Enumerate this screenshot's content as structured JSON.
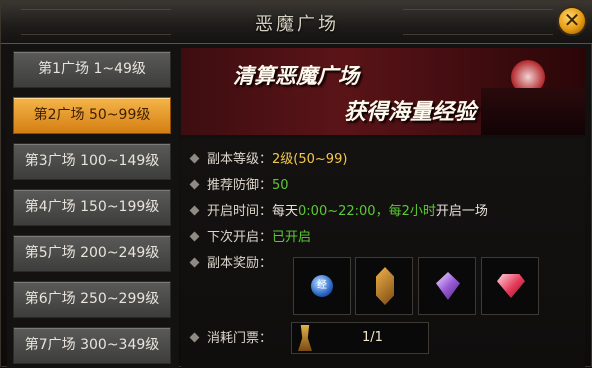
{
  "window": {
    "title": "恶魔广场"
  },
  "sidebar": {
    "items": [
      {
        "label": "第1广场 1~49级",
        "active": false
      },
      {
        "label": "第2广场 50~99级",
        "active": true
      },
      {
        "label": "第3广场 100~149级",
        "active": false
      },
      {
        "label": "第4广场 150~199级",
        "active": false
      },
      {
        "label": "第5广场 200~249级",
        "active": false
      },
      {
        "label": "第6广场 250~299级",
        "active": false
      },
      {
        "label": "第7广场 300~349级",
        "active": false
      }
    ]
  },
  "banner": {
    "line1": "清算恶魔广场",
    "line2": "获得海量经验"
  },
  "info": {
    "level_label": "副本等级：",
    "level_value": "2级(50~99)",
    "defense_label": "推荐防御：",
    "defense_value": "50",
    "open_label": "开启时间：",
    "open_value_a": "每天",
    "open_value_b": "0:00~22:00，",
    "open_value_c": "每2小时",
    "open_value_d": "开启一场",
    "next_label": "下次开启：",
    "next_value": "已开启",
    "reward_label": "副本奖励：",
    "cost_label": "消耗门票："
  },
  "rewards": [
    {
      "icon": "blue-orb-icon",
      "text": "经"
    },
    {
      "icon": "amber-crystal-icon"
    },
    {
      "icon": "purple-gem-icon"
    },
    {
      "icon": "red-gem-icon"
    }
  ],
  "ticket": {
    "icon": "ticket-icon",
    "count": "1/1"
  },
  "colors": {
    "active_tab": "#e29a2a",
    "value_yellow": "#f2c94c",
    "value_green": "#5bc936",
    "close_button": "#f0a81c"
  }
}
